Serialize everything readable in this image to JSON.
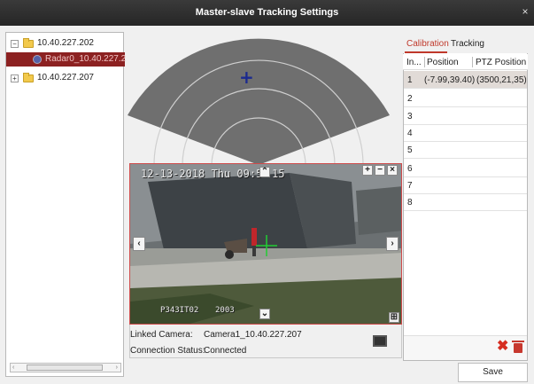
{
  "window": {
    "title": "Master-slave Tracking Settings",
    "close_glyph": "×"
  },
  "tree": {
    "items": [
      {
        "toggle": "−",
        "label": "10.40.227.202",
        "icon": "folder-icon"
      },
      {
        "label": "Radar0_10.40.227.2",
        "icon": "radar-icon",
        "selected": true
      },
      {
        "toggle": "+",
        "label": "10.40.227.207",
        "icon": "folder-icon"
      }
    ],
    "scroll_left": "‹",
    "scroll_right": "›"
  },
  "radar": {
    "marker_glyph": "+",
    "rings": 3,
    "colors": {
      "fill": "#6f6f6f",
      "ring": "#cfcfcf",
      "marker": "#1b2a8f"
    }
  },
  "video": {
    "osd_datetime": "12-13-2018 Thu 09:5",
    "osd_seconds": "15",
    "osd_camera": "P343IT02",
    "osd_number": "2003",
    "controls": {
      "zoom_in": "+",
      "zoom_out": "−",
      "close": "×",
      "up": "⌃",
      "down": "⌄",
      "left": "‹",
      "right": "›"
    },
    "crosshair_color": "#22cc33",
    "border_color": "#cf4b4b"
  },
  "info": {
    "linked_camera_label": "Linked Camera:",
    "linked_camera_value": "Camera1_10.40.227.207",
    "connection_status_label": "Connection Status:",
    "connection_status_value": "Connected"
  },
  "right_panel": {
    "tabs": [
      {
        "label": "Calibration",
        "active": true
      },
      {
        "label": "Tracking",
        "active": false
      }
    ],
    "columns": [
      "In...",
      "Position",
      "PTZ Position"
    ],
    "rows": [
      {
        "index": "1",
        "position": "(-7.99,39.40)",
        "ptz": "(3500,21,35)",
        "selected": true
      },
      {
        "index": "2",
        "position": "",
        "ptz": ""
      },
      {
        "index": "3",
        "position": "",
        "ptz": ""
      },
      {
        "index": "4",
        "position": "",
        "ptz": ""
      },
      {
        "index": "5",
        "position": "",
        "ptz": ""
      },
      {
        "index": "6",
        "position": "",
        "ptz": ""
      },
      {
        "index": "7",
        "position": "",
        "ptz": ""
      },
      {
        "index": "8",
        "position": "",
        "ptz": ""
      }
    ],
    "delete_glyph": "✖",
    "accent_color": "#c0392b"
  },
  "footer": {
    "save_label": "Save"
  }
}
